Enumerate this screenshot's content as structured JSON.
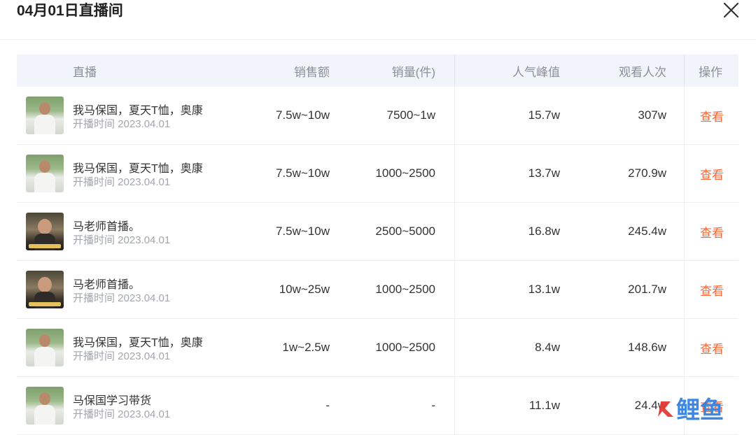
{
  "header": {
    "title": "04月01日直播间"
  },
  "columns": {
    "live": "直播",
    "sales_amount": "销售额",
    "sales_volume": "销量(件)",
    "peak_popularity": "人气峰值",
    "views": "观看人次",
    "action": "操作"
  },
  "rows": [
    {
      "thumb_icon": "person-outdoor",
      "name": "我马保国，夏天T恤，奥康",
      "time": "开播时间 2023.04.01",
      "sales_amount": "7.5w~10w",
      "sales_volume": "7500~1w",
      "peak": "15.7w",
      "views": "307w",
      "action": "查看"
    },
    {
      "thumb_icon": "person-outdoor",
      "name": "我马保国，夏天T恤，奥康",
      "time": "开播时间 2023.04.01",
      "sales_amount": "7.5w~10w",
      "sales_volume": "1000~2500",
      "peak": "13.7w",
      "views": "270.9w",
      "action": "查看"
    },
    {
      "thumb_icon": "person-indoor",
      "name": "马老师首播。",
      "time": "开播时间 2023.04.01",
      "sales_amount": "7.5w~10w",
      "sales_volume": "2500~5000",
      "peak": "16.8w",
      "views": "245.4w",
      "action": "查看"
    },
    {
      "thumb_icon": "person-indoor",
      "name": "马老师首播。",
      "time": "开播时间 2023.04.01",
      "sales_amount": "10w~25w",
      "sales_volume": "1000~2500",
      "peak": "13.1w",
      "views": "201.7w",
      "action": "查看"
    },
    {
      "thumb_icon": "person-outdoor",
      "name": "我马保国，夏天T恤，奥康",
      "time": "开播时间 2023.04.01",
      "sales_amount": "1w~2.5w",
      "sales_volume": "1000~2500",
      "peak": "8.4w",
      "views": "148.6w",
      "action": "查看"
    },
    {
      "thumb_icon": "person-outdoor",
      "name": "马保国学习带货",
      "time": "开播时间 2023.04.01",
      "sales_amount": "-",
      "sales_volume": "-",
      "peak": "11.1w",
      "views": "24.4w",
      "action": "查看"
    }
  ],
  "watermark": {
    "text": "鲤鱼"
  },
  "colors": {
    "accent": "#f26a3a",
    "header_bg": "#f2f4fb",
    "watermark_blue": "#2f7ee0",
    "watermark_red": "#e53935"
  }
}
